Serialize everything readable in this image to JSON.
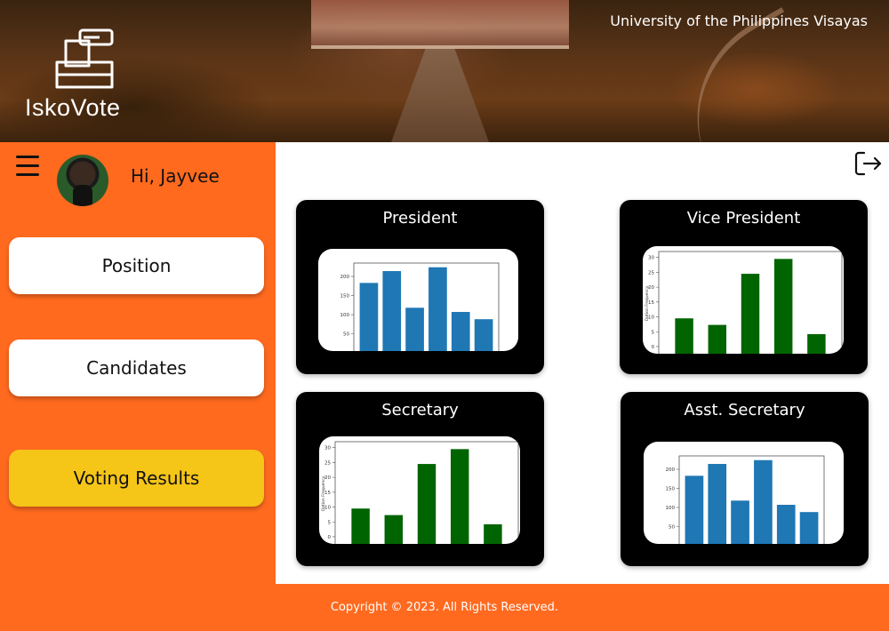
{
  "header": {
    "app_name": "IskoVote",
    "university": "University of the Philippines Visayas"
  },
  "sidebar": {
    "greeting": "Hi, Jayvee",
    "nav": [
      {
        "label": "Position",
        "active": false
      },
      {
        "label": "Candidates",
        "active": false
      },
      {
        "label": "Voting Results",
        "active": true
      }
    ]
  },
  "cards": [
    {
      "title": "President",
      "chart_data": {
        "type": "bar",
        "values": [
          183,
          214,
          118,
          224,
          107,
          88
        ],
        "color": "#1f77b4",
        "ytick_labels": [
          "50",
          "100",
          "150",
          "200"
        ]
      }
    },
    {
      "title": "Vice President",
      "chart_data": {
        "type": "bar",
        "values": [
          9.5,
          7.3,
          24.5,
          29.5,
          4.2
        ],
        "color": "#006400",
        "ylabel": "Option Frequency",
        "ytick_labels": [
          "0",
          "5",
          "10",
          "15",
          "20",
          "25",
          "30"
        ]
      }
    },
    {
      "title": "Secretary",
      "chart_data": {
        "type": "bar",
        "values": [
          9.5,
          7.3,
          24.5,
          29.5,
          4.2
        ],
        "color": "#006400",
        "ylabel": "Option Frequency",
        "ytick_labels": [
          "0",
          "5",
          "10",
          "15",
          "20",
          "25",
          "30"
        ]
      }
    },
    {
      "title": "Asst. Secretary",
      "chart_data": {
        "type": "bar",
        "values": [
          183,
          214,
          118,
          224,
          107,
          88
        ],
        "color": "#1f77b4",
        "ytick_labels": [
          "50",
          "100",
          "150",
          "200"
        ]
      }
    }
  ],
  "footer": {
    "copyright": "Copyright © 2023. All Rights Reserved."
  }
}
